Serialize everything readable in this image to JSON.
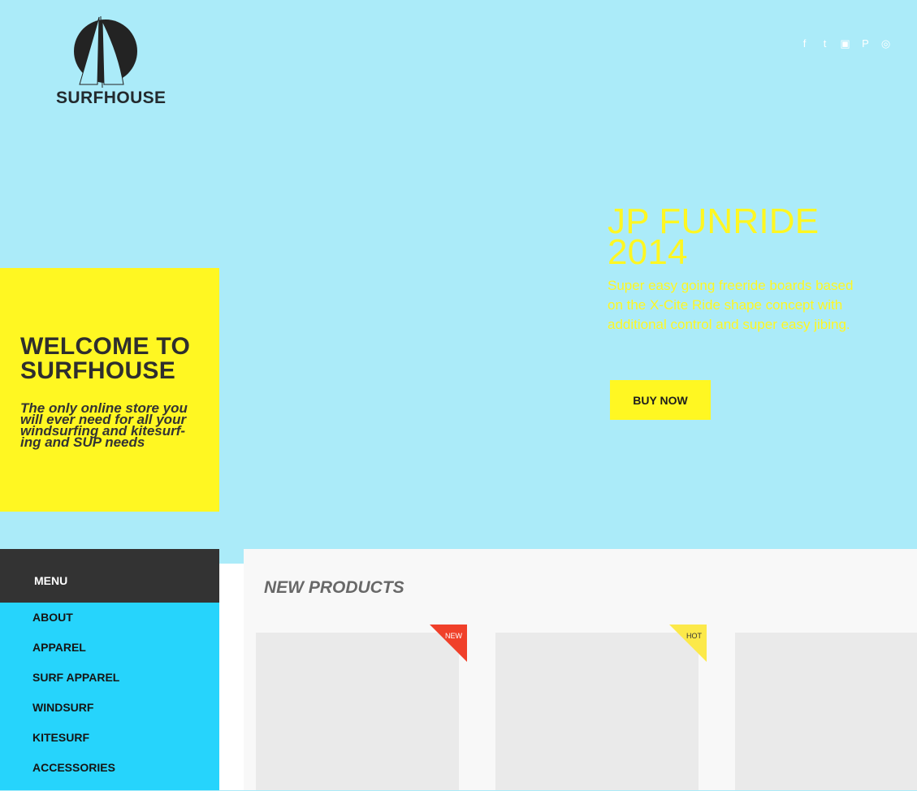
{
  "logo": {
    "name": "SURFHOUSE"
  },
  "social": [
    {
      "icon": "facebook-icon",
      "glyph": "f"
    },
    {
      "icon": "twitter-icon",
      "glyph": "t"
    },
    {
      "icon": "youtube-icon",
      "glyph": "▣"
    },
    {
      "icon": "pinterest-icon",
      "glyph": "P"
    },
    {
      "icon": "instagram-icon",
      "glyph": "◎"
    }
  ],
  "welcome": {
    "title": "WELCOME TO SURFHOUSE",
    "text": "The only online store you will ever need for all your windsurfing and kitesurf-ing and SUP needs"
  },
  "promo": {
    "title": "JP FUNRIDE 2014",
    "text": "Super easy going freeride boards based on the X-Cite Ride shape concept with additional control and super easy jibing.",
    "button": "BUY NOW"
  },
  "menu": {
    "title": "MENU",
    "items": [
      "ABOUT",
      "APPAREL",
      "SURF APPAREL",
      "WINDSURF",
      "KITESURF",
      "ACCESSORIES"
    ]
  },
  "products": {
    "heading": "NEW PRODUCTS",
    "badges": [
      {
        "label": "NEW",
        "color": "#f0402a",
        "text_color": "#ffffff"
      },
      {
        "label": "HOT",
        "color": "#fce94a",
        "text_color": "#333333"
      }
    ]
  },
  "colors": {
    "sky": "#abebf9",
    "yellow": "#fff722",
    "menu_bg": "#26d4fc",
    "menu_head": "#333333"
  }
}
